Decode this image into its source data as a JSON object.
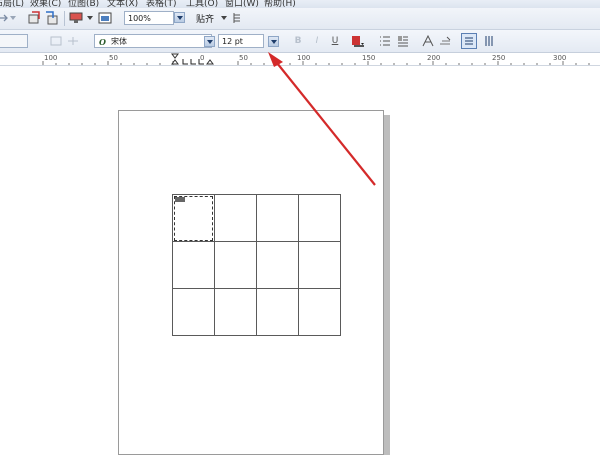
{
  "menu": {
    "items": [
      "布局(L)",
      "效果(C)",
      "位图(B)",
      "文本(X)",
      "表格(T)",
      "工具(O)",
      "窗口(W)",
      "帮助(H)"
    ]
  },
  "toolbar1": {
    "zoom_value": "100%",
    "snap_label": "贴齐"
  },
  "toolbar2": {
    "font_name": "宋体",
    "font_size": "12 pt"
  },
  "ruler": {
    "labels": [
      "100",
      "50",
      "0",
      "50",
      "100",
      "150",
      "200",
      "250",
      "300"
    ]
  },
  "table": {
    "rows": 3,
    "cols": 4
  },
  "colors": {
    "annotation_arrow": "#d42a2a",
    "toolbar_bg": "#e4eaf3",
    "table_border": "#5a5a5a"
  }
}
